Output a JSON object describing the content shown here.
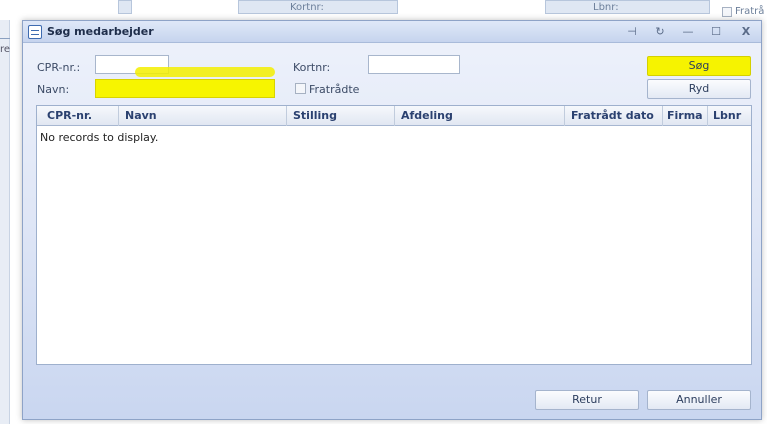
{
  "background": {
    "kortnr_label": "Kortnr:",
    "lbnr_label": "Lbnr:",
    "fratraadt_label": "Fratrå",
    "left_fragment": "re"
  },
  "dialog": {
    "title": "Søg medarbejder",
    "window_controls": {
      "pin": "⊣",
      "refresh": "↻",
      "minimize": "—",
      "maximize": "☐",
      "close": "X"
    }
  },
  "form": {
    "cpr_label": "CPR-nr.:",
    "cpr_value": "",
    "navn_label": "Navn:",
    "navn_value": "",
    "kortnr_label": "Kortnr:",
    "kortnr_value": "",
    "fratraadte_label": "Fratrådte",
    "fratraadte_checked": false,
    "search_button": "Søg",
    "clear_button": "Ryd"
  },
  "grid": {
    "columns": [
      "CPR-nr.",
      "Navn",
      "Stilling",
      "Afdeling",
      "Fratrådt dato",
      "Firma",
      "Lbnr"
    ],
    "empty_message": "No records to display."
  },
  "footer": {
    "return_button": "Retur",
    "cancel_button": "Annuller"
  },
  "colors": {
    "highlight": "#f6f300",
    "header_text": "#2b4170",
    "dialog_border": "#8ea3c7"
  }
}
